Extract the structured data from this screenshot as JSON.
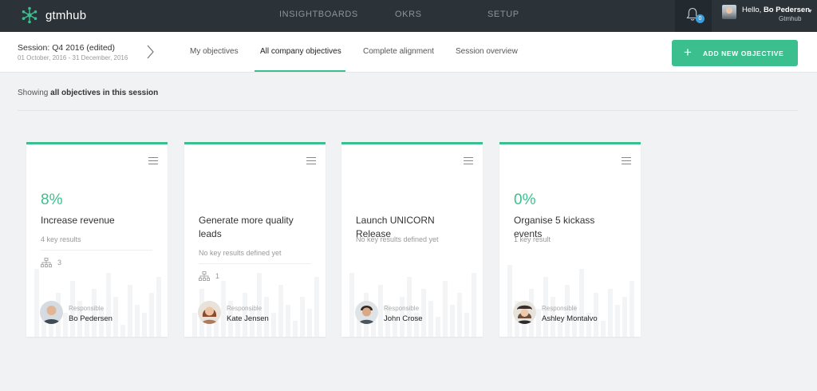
{
  "app": {
    "name": "gtmhub"
  },
  "topnav": [
    {
      "label": "INSIGHTBOARDS"
    },
    {
      "label": "OKRS"
    },
    {
      "label": "SETUP"
    }
  ],
  "notifications": {
    "count": "0"
  },
  "user": {
    "greeting": "Hello,",
    "name": "Bo Pedersen",
    "org": "Gtmhub"
  },
  "session": {
    "title": "Session: Q4 2016 (edited)",
    "dates": "01 October, 2016 - 31 December, 2016"
  },
  "tabs": [
    {
      "label": "My objectives",
      "active": false
    },
    {
      "label": "All company objectives",
      "active": true
    },
    {
      "label": "Complete alignment",
      "active": false
    },
    {
      "label": "Session overview",
      "active": false
    }
  ],
  "add_button": {
    "icon": "+",
    "label": "ADD NEW OBJECTIVE"
  },
  "showing": {
    "prefix": "Showing",
    "emphasis": "all objectives in this session"
  },
  "colors": {
    "accent": "#3cbf8f",
    "topbar": "#2b3238",
    "badge": "#39a0e0"
  },
  "objectives": [
    {
      "progress": "8%",
      "title": "Increase revenue",
      "key_results": "4 key results",
      "aligned_count": "3",
      "responsible_label": "Responsible",
      "owner": "Bo Pedersen"
    },
    {
      "progress": "",
      "title": "Generate more quality leads",
      "key_results": "No key results defined yet",
      "aligned_count": "1",
      "responsible_label": "Responsible",
      "owner": "Kate Jensen"
    },
    {
      "progress": "",
      "title": "Launch UNICORN Release",
      "key_results": "No key results defined yet",
      "aligned_count": "",
      "responsible_label": "Responsible",
      "owner": "John Crose"
    },
    {
      "progress": "0%",
      "title": "Organise 5 kickass events",
      "key_results": "1 key result",
      "aligned_count": "",
      "responsible_label": "Responsible",
      "owner": "Ashley Montalvo"
    }
  ]
}
